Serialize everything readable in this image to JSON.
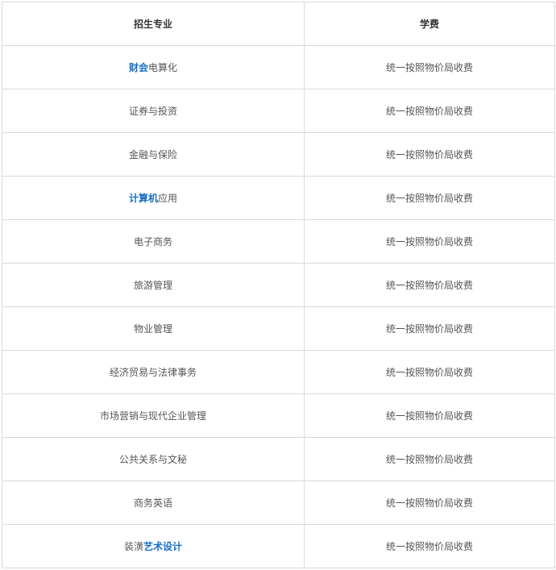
{
  "table": {
    "headers": {
      "major": "招生专业",
      "fee": "学费"
    },
    "rows": [
      {
        "major_link": "财会",
        "major_text": "电算化",
        "fee": "统一按照物价局收费"
      },
      {
        "major_link": "",
        "major_text": "证券与投资",
        "fee": "统一按照物价局收费"
      },
      {
        "major_link": "",
        "major_text": "金融与保险",
        "fee": "统一按照物价局收费"
      },
      {
        "major_link": "计算机",
        "major_text": "应用",
        "fee": "统一按照物价局收费"
      },
      {
        "major_link": "",
        "major_text": "电子商务",
        "fee": "统一按照物价局收费"
      },
      {
        "major_link": "",
        "major_text": "旅游管理",
        "fee": "统一按照物价局收费"
      },
      {
        "major_link": "",
        "major_text": "物业管理",
        "fee": "统一按照物价局收费"
      },
      {
        "major_link": "",
        "major_text": "经济贸易与法律事务",
        "fee": "统一按照物价局收费"
      },
      {
        "major_link": "",
        "major_text": "市场营销与现代企业管理",
        "fee": "统一按照物价局收费"
      },
      {
        "major_link": "",
        "major_text": "公共关系与文秘",
        "fee": "统一按照物价局收费"
      },
      {
        "major_link": "",
        "major_text": "商务英语",
        "fee": "统一按照物价局收费"
      },
      {
        "major_prefix": "装潢",
        "major_link": "艺术设计",
        "major_text": "",
        "fee": "统一按照物价局收费"
      }
    ],
    "colors": {
      "link": "#1a6fc7",
      "border": "#d9d9d9",
      "text": "#555555"
    }
  }
}
